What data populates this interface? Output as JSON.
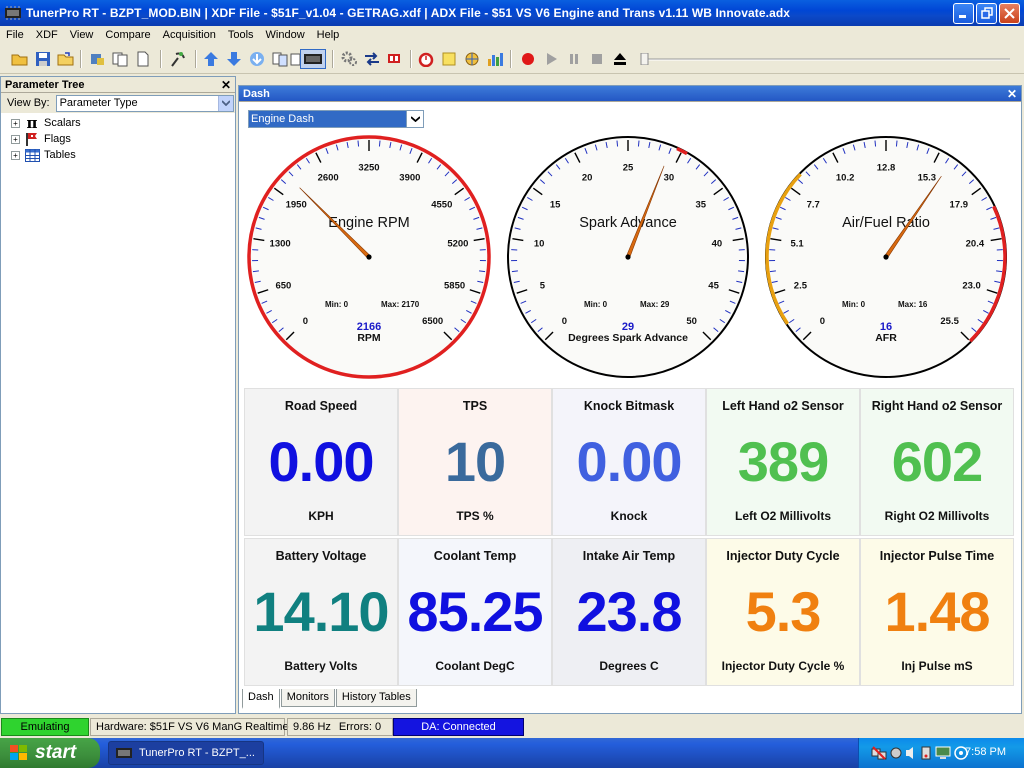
{
  "window": {
    "title": "TunerPro RT - BZPT_MOD.BIN | XDF File - $51F_v1.04 - GETRAG.xdf | ADX File - $51 VS V6 Engine and Trans v1.11 WB Innovate.adx"
  },
  "menu": [
    "File",
    "XDF",
    "View",
    "Compare",
    "Acquisition",
    "Tools",
    "Window",
    "Help"
  ],
  "left_panel": {
    "title": "Parameter Tree",
    "view_by_label": "View By:",
    "view_by_value": "Parameter Type",
    "tree": [
      {
        "label": "Scalars",
        "icon": "pi-icon"
      },
      {
        "label": "Flags",
        "icon": "flag-icon"
      },
      {
        "label": "Tables",
        "icon": "table-icon"
      }
    ]
  },
  "dash": {
    "title": "Dash",
    "selector": "Engine Dash",
    "gauges": [
      {
        "title": "Engine RPM",
        "unit": "RPM",
        "value": "2166",
        "value_num": 2166,
        "min": 0,
        "max": 6500,
        "ticks": [
          "0",
          "650",
          "1300",
          "1950",
          "2600",
          "3250",
          "3900",
          "4550",
          "5200",
          "5850",
          "6500"
        ],
        "min_label": "Min: 0",
        "max_label": "Max: 2170",
        "arc_color": "#e02020",
        "arc_start_frac": 0,
        "arc_end_frac": 1
      },
      {
        "title": "Spark Advance",
        "unit": "Degrees Spark Advance",
        "value": "29",
        "value_num": 29,
        "min": 0,
        "max": 50,
        "ticks": [
          "0",
          "5",
          "10",
          "15",
          "20",
          "25",
          "30",
          "35",
          "40",
          "45",
          "50"
        ],
        "min_label": "Min: 0",
        "max_label": "Max: 29",
        "arc_color": "#e02020",
        "arc_start_frac": 0.59,
        "arc_end_frac": 0.61
      },
      {
        "title": "Air/Fuel Ratio",
        "unit": "AFR",
        "value": "16",
        "value_num": 16,
        "min": 0,
        "max": 25.5,
        "ticks": [
          "0",
          "2.5",
          "5.1",
          "7.7",
          "10.2",
          "12.8",
          "15.3",
          "17.9",
          "20.4",
          "23.0",
          "25.5"
        ],
        "min_label": "Min: 0",
        "max_label": "Max: 16",
        "arc_color": "#e8a010",
        "arc_start_frac": 0.04,
        "arc_end_frac": 0.33,
        "arc2_color": "#e02020",
        "arc2_start_frac": 0.74,
        "arc2_end_frac": 1
      }
    ],
    "tiles": [
      {
        "title": "Road Speed",
        "value": "0.00",
        "unit": "KPH",
        "color": "#1010e0",
        "bg": "#f3f3f3"
      },
      {
        "title": "TPS",
        "value": "10",
        "unit": "TPS %",
        "color": "#3a6a9c",
        "bg": "#fdf3f0"
      },
      {
        "title": "Knock Bitmask",
        "value": "0.00",
        "unit": "Knock",
        "color": "#4060e0",
        "bg": "#f4f4fa"
      },
      {
        "title": "Left Hand o2 Sensor",
        "value": "389",
        "unit": "Left O2 Millivolts",
        "color": "#50c050",
        "bg": "#f2faf2"
      },
      {
        "title": "Right Hand o2 Sensor",
        "value": "602",
        "unit": "Right O2 Millivolts",
        "color": "#50c050",
        "bg": "#f2faf2"
      },
      {
        "title": "Battery Voltage",
        "value": "14.10",
        "unit": "Battery Volts",
        "color": "#108080",
        "bg": "#f3f3f3"
      },
      {
        "title": "Coolant Temp",
        "value": "85.25",
        "unit": "Coolant DegC",
        "color": "#1010e0",
        "bg": "#f4f6fb"
      },
      {
        "title": "Intake Air Temp",
        "value": "23.8",
        "unit": "Degrees C",
        "color": "#1010e0",
        "bg": "#eeeff3"
      },
      {
        "title": "Injector Duty Cycle",
        "value": "5.3",
        "unit": "Injector Duty Cycle %",
        "color": "#f08010",
        "bg": "#fdfbe8"
      },
      {
        "title": "Injector Pulse Time",
        "value": "1.48",
        "unit": "Inj Pulse mS",
        "color": "#f08010",
        "bg": "#fdfbe8"
      }
    ],
    "tabs": [
      "Dash",
      "Monitors",
      "History Tables"
    ],
    "active_tab": "Dash"
  },
  "status": {
    "mode": "Emulating",
    "hardware": "Hardware: $51F VS V6 ManG Realtime",
    "rate": "9.86 Hz",
    "errors": "Errors: 0",
    "da": "DA: Connected"
  },
  "taskbar": {
    "start": "start",
    "task": "TunerPro RT - BZPT_...",
    "clock": "7:58 PM"
  },
  "icons": [
    "open-icon",
    "save-icon",
    "folder-icon",
    "chip-icon",
    "copy-icon",
    "new-icon",
    "probe-icon",
    "up-arrow-icon",
    "down-arrow-icon",
    "download-icon",
    "compare-icon",
    "pages-icon",
    "emulator-icon",
    "gear-icon",
    "swap-arrows-icon",
    "flag-bar-icon",
    "stopwatch-icon",
    "note-icon",
    "globe-icon",
    "bar-chart-icon",
    "record-icon",
    "play-icon",
    "pause-icon",
    "stop-icon",
    "eject-icon"
  ]
}
